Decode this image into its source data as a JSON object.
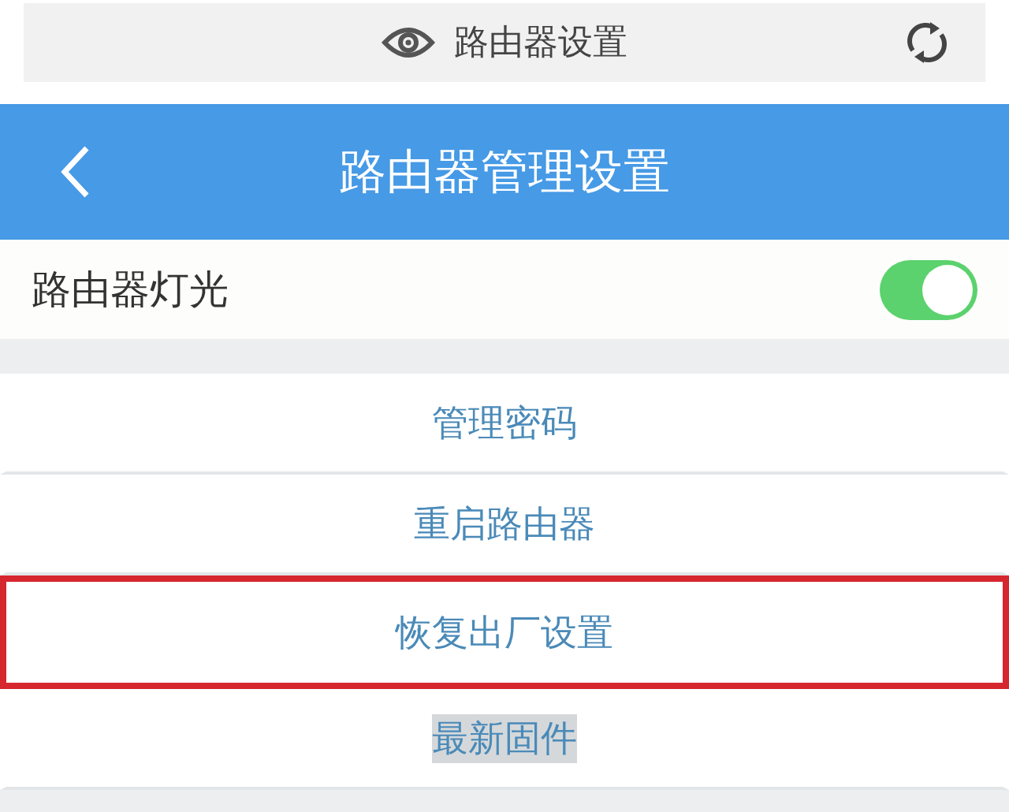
{
  "browser_bar": {
    "title": "路由器设置"
  },
  "header": {
    "title": "路由器管理设置"
  },
  "toggle_row": {
    "label": "路由器灯光",
    "on": true
  },
  "menu_items": [
    {
      "label": "管理密码",
      "highlighted": false,
      "text_selected": false
    },
    {
      "label": "重启路由器",
      "highlighted": false,
      "text_selected": false
    },
    {
      "label": "恢复出厂设置",
      "highlighted": true,
      "text_selected": false
    },
    {
      "label": "最新固件",
      "highlighted": false,
      "text_selected": true
    }
  ]
}
